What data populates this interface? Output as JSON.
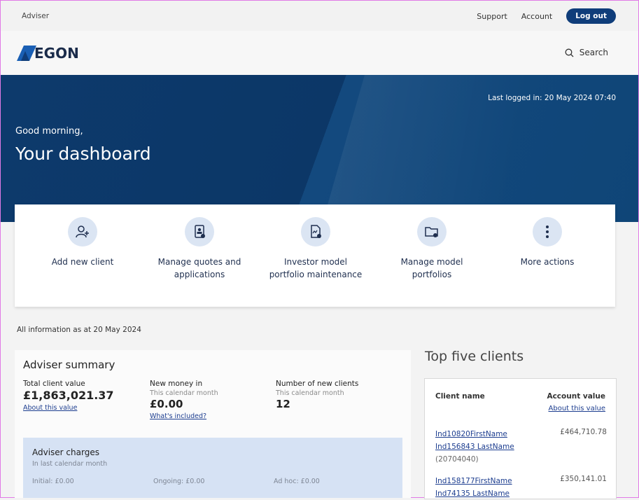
{
  "utility": {
    "left_label": "Adviser",
    "support": "Support",
    "account": "Account",
    "logout": "Log out"
  },
  "brand": {
    "logo_text": "EGON",
    "search_label": "Search"
  },
  "hero": {
    "last_logged": "Last logged in: 20 May 2024 07:40",
    "greeting": "Good morning,",
    "title": "Your dashboard"
  },
  "actions": [
    {
      "label": "Add new client",
      "icon": "add-user-icon"
    },
    {
      "label": "Manage quotes and applications",
      "icon": "document-user-icon"
    },
    {
      "label": "Investor model portfolio maintenance",
      "icon": "document-settings-icon"
    },
    {
      "label": "Manage model portfolios",
      "icon": "folder-settings-icon"
    },
    {
      "label": "More actions",
      "icon": "more-vertical-icon"
    }
  ],
  "info_date": "All information as at 20 May 2024",
  "summary": {
    "title": "Adviser summary",
    "total": {
      "title": "Total client value",
      "value": "£1,863,021.37",
      "link": "About this value"
    },
    "new_money": {
      "title": "New money in",
      "sub": "This calendar month",
      "value": "£0.00",
      "link": "What's included?"
    },
    "new_clients": {
      "title": "Number of new clients",
      "sub": "This calendar month",
      "value": "12"
    },
    "charges": {
      "title": "Adviser charges",
      "sub": "In last calendar month",
      "initial": "Initial: £0.00",
      "ongoing": "Ongoing: £0.00",
      "adhoc": "Ad hoc: £0.00"
    }
  },
  "top5": {
    "title": "Top five clients",
    "col_name": "Client name",
    "col_value": "Account value",
    "about": "About this value",
    "clients": [
      {
        "line1": "Ind10820FirstName",
        "line2": "Ind156843 LastName",
        "ref": "(20704040)",
        "value": "£464,710.78"
      },
      {
        "line1": "Ind158177FirstName",
        "line2": "Ind74135 LastName",
        "ref": "",
        "value": "£350,141.01"
      }
    ]
  },
  "colors": {
    "brand_navy": "#0f3d7a",
    "hero_blue": "#0d3a6c",
    "link_blue": "#1c3d8f",
    "icon_circle": "#dbe5f3",
    "charges_bg": "#d6e2f4"
  }
}
